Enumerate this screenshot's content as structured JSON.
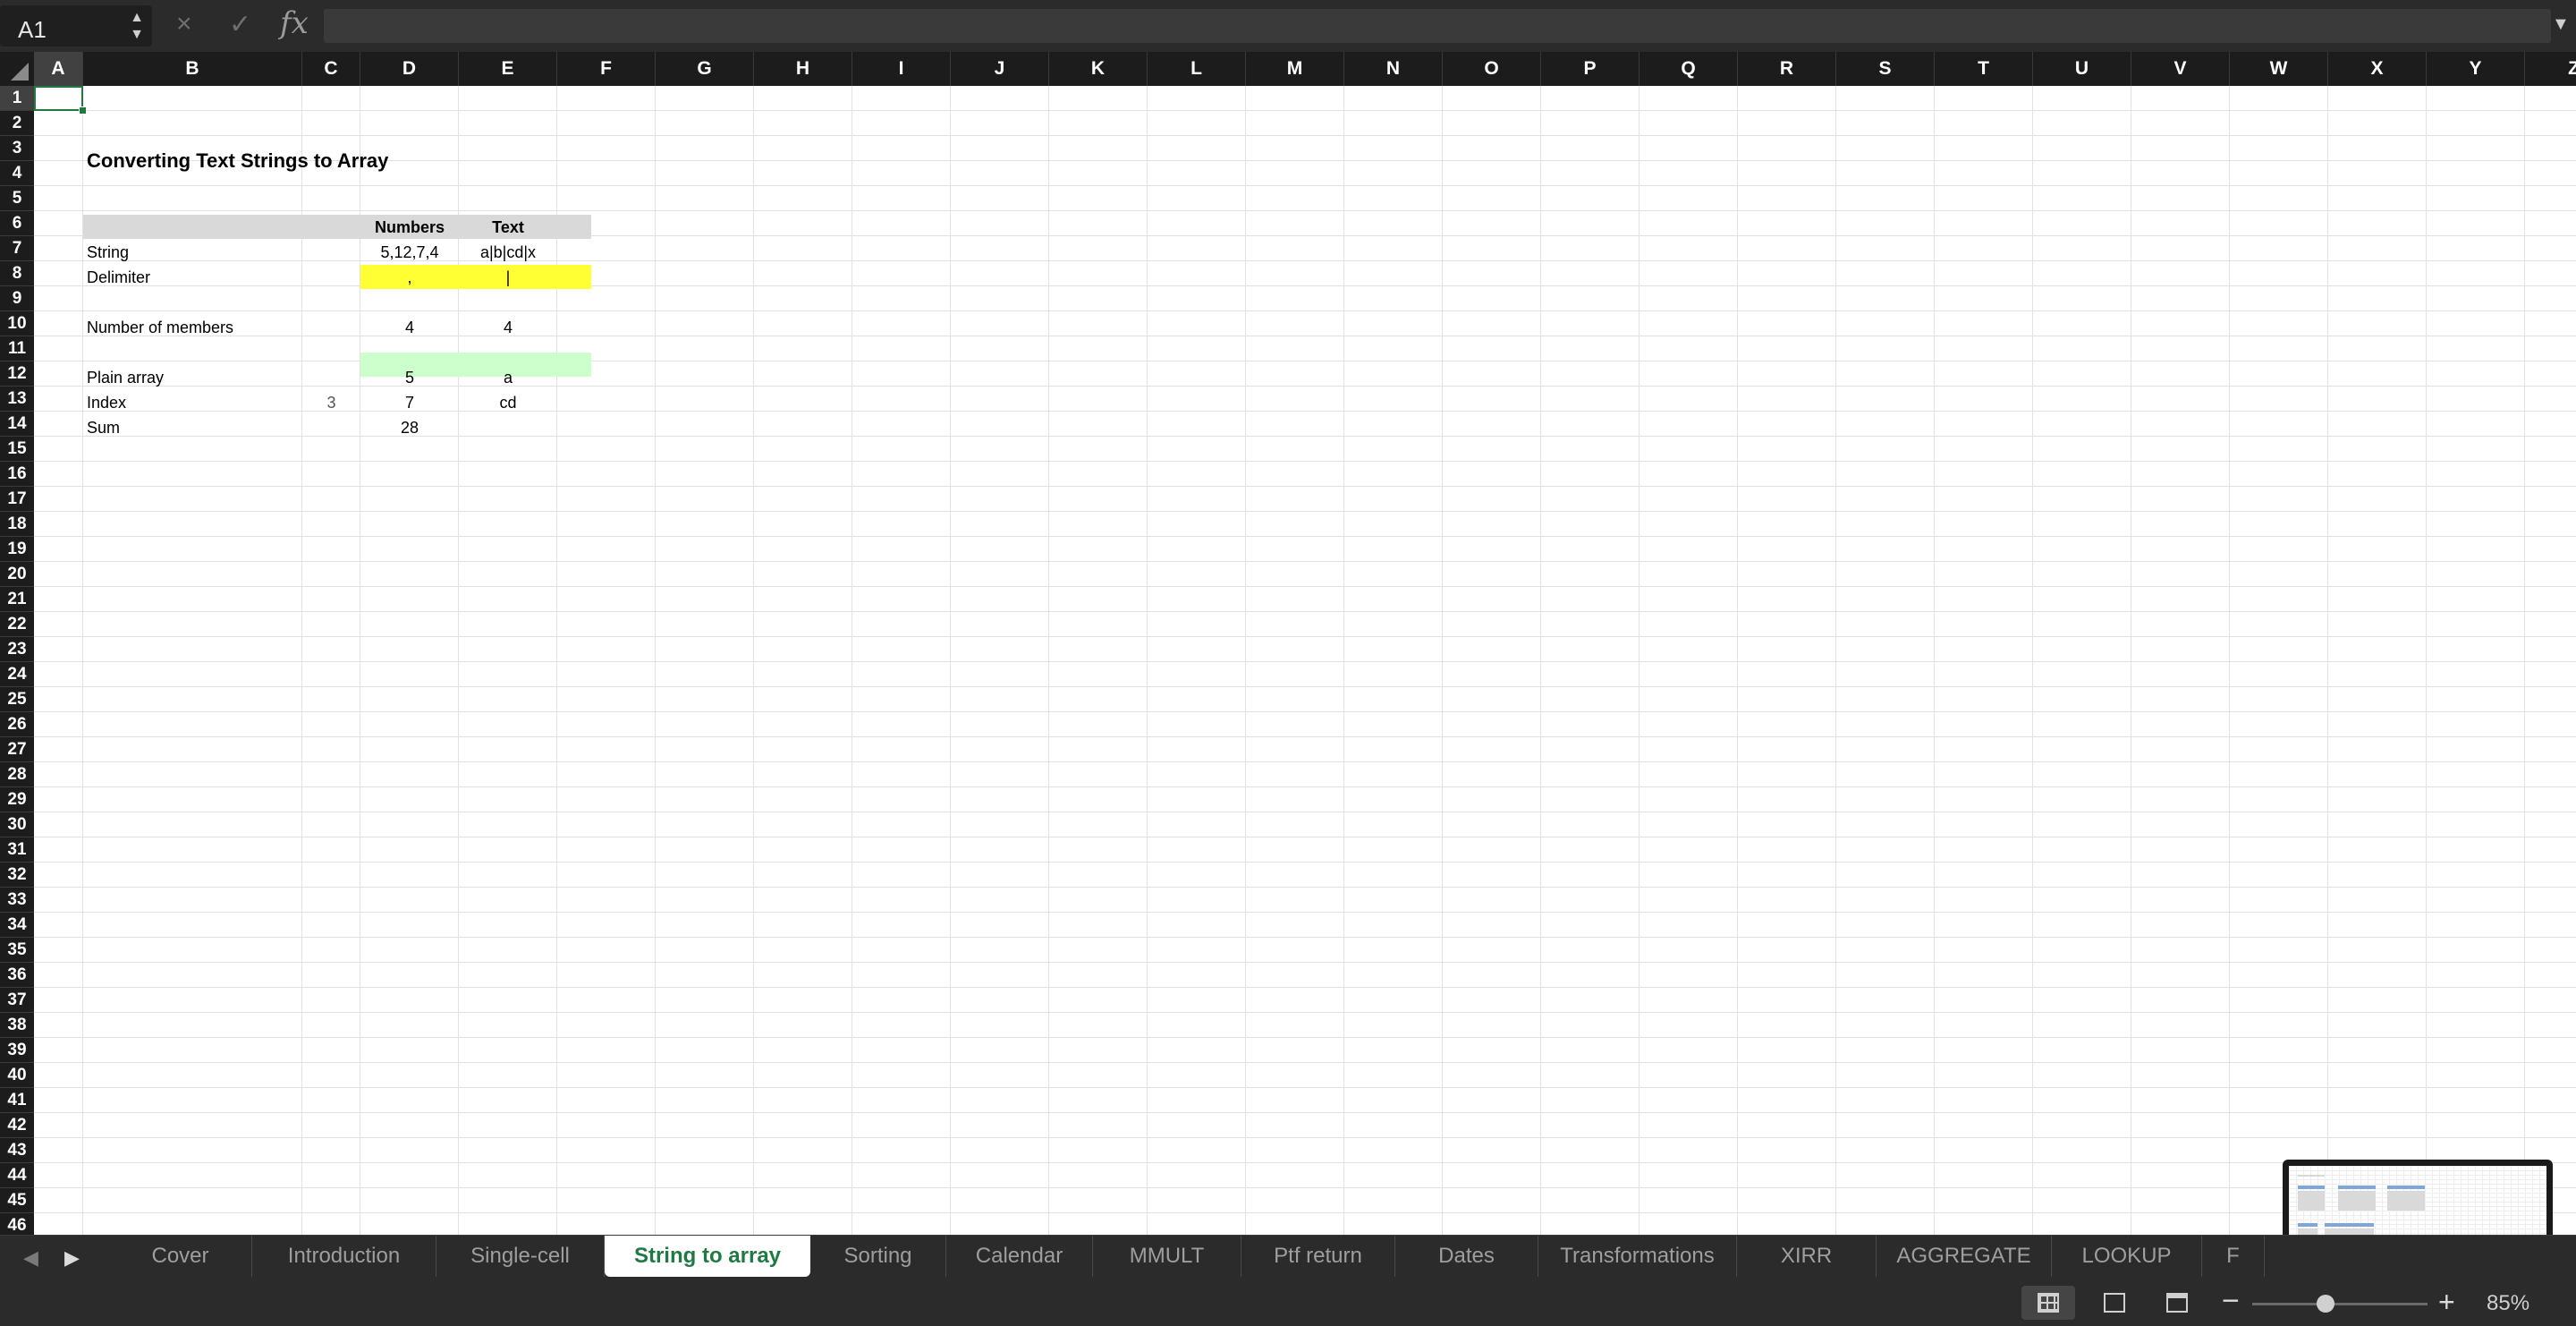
{
  "formula_bar": {
    "name_box": "A1",
    "cancel_icon": "×",
    "confirm_icon": "✓",
    "fx_label": "fx",
    "formula": ""
  },
  "columns": [
    "A",
    "B",
    "C",
    "D",
    "E",
    "F",
    "G",
    "H",
    "I",
    "J",
    "K",
    "L",
    "M",
    "N",
    "O",
    "P",
    "Q",
    "R",
    "S",
    "T",
    "U",
    "V",
    "W",
    "X",
    "Y",
    "Z"
  ],
  "selected_column": "A",
  "rows": [
    "1",
    "2",
    "3",
    "4",
    "5",
    "6",
    "7",
    "8",
    "9",
    "10",
    "11",
    "12",
    "13",
    "14",
    "15",
    "16",
    "17",
    "18",
    "19",
    "20",
    "21",
    "22",
    "23",
    "24",
    "25",
    "26",
    "27",
    "28",
    "29",
    "30",
    "31",
    "32",
    "33",
    "34",
    "35",
    "36",
    "37",
    "38",
    "39",
    "40",
    "41",
    "42",
    "43",
    "44",
    "45",
    "46"
  ],
  "selected_row": "1",
  "sheet": {
    "title": "Converting Text Strings to Array",
    "header_numbers": "Numbers",
    "header_text": "Text",
    "string_label": "String",
    "string_numbers": "5,12,7,4",
    "string_text": "a|b|cd|x",
    "delimiter_label": "Delimiter",
    "delimiter_numbers": ",",
    "delimiter_text": "|",
    "members_label": "Number of members",
    "members_numbers": "4",
    "members_text": "4",
    "plain_label": "Plain array",
    "plain_numbers": "5",
    "plain_text": "a",
    "index_label": "Index",
    "index_value": "3",
    "index_numbers": "7",
    "index_text": "cd",
    "sum_label": "Sum",
    "sum_numbers": "28"
  },
  "colors": {
    "header_fill": "#d9d9d9",
    "delimiter_fill": "#ffff33",
    "plain_fill": "#ccffcc",
    "active_tab_text": "#1e7a43",
    "selection": "#1f7a3f"
  },
  "tabs": {
    "prev_icon": "◀",
    "next_icon": "▶",
    "items": [
      "Cover",
      "Introduction",
      "Single-cell",
      "String to array",
      "Sorting",
      "Calendar",
      "MMULT",
      "Ptf return",
      "Dates",
      "Transformations",
      "XIRR",
      "AGGREGATE",
      "LOOKUP",
      "F"
    ],
    "active": "String to array"
  },
  "status_bar": {
    "zoom_minus": "−",
    "zoom_plus": "+",
    "zoom_level": "85%"
  }
}
